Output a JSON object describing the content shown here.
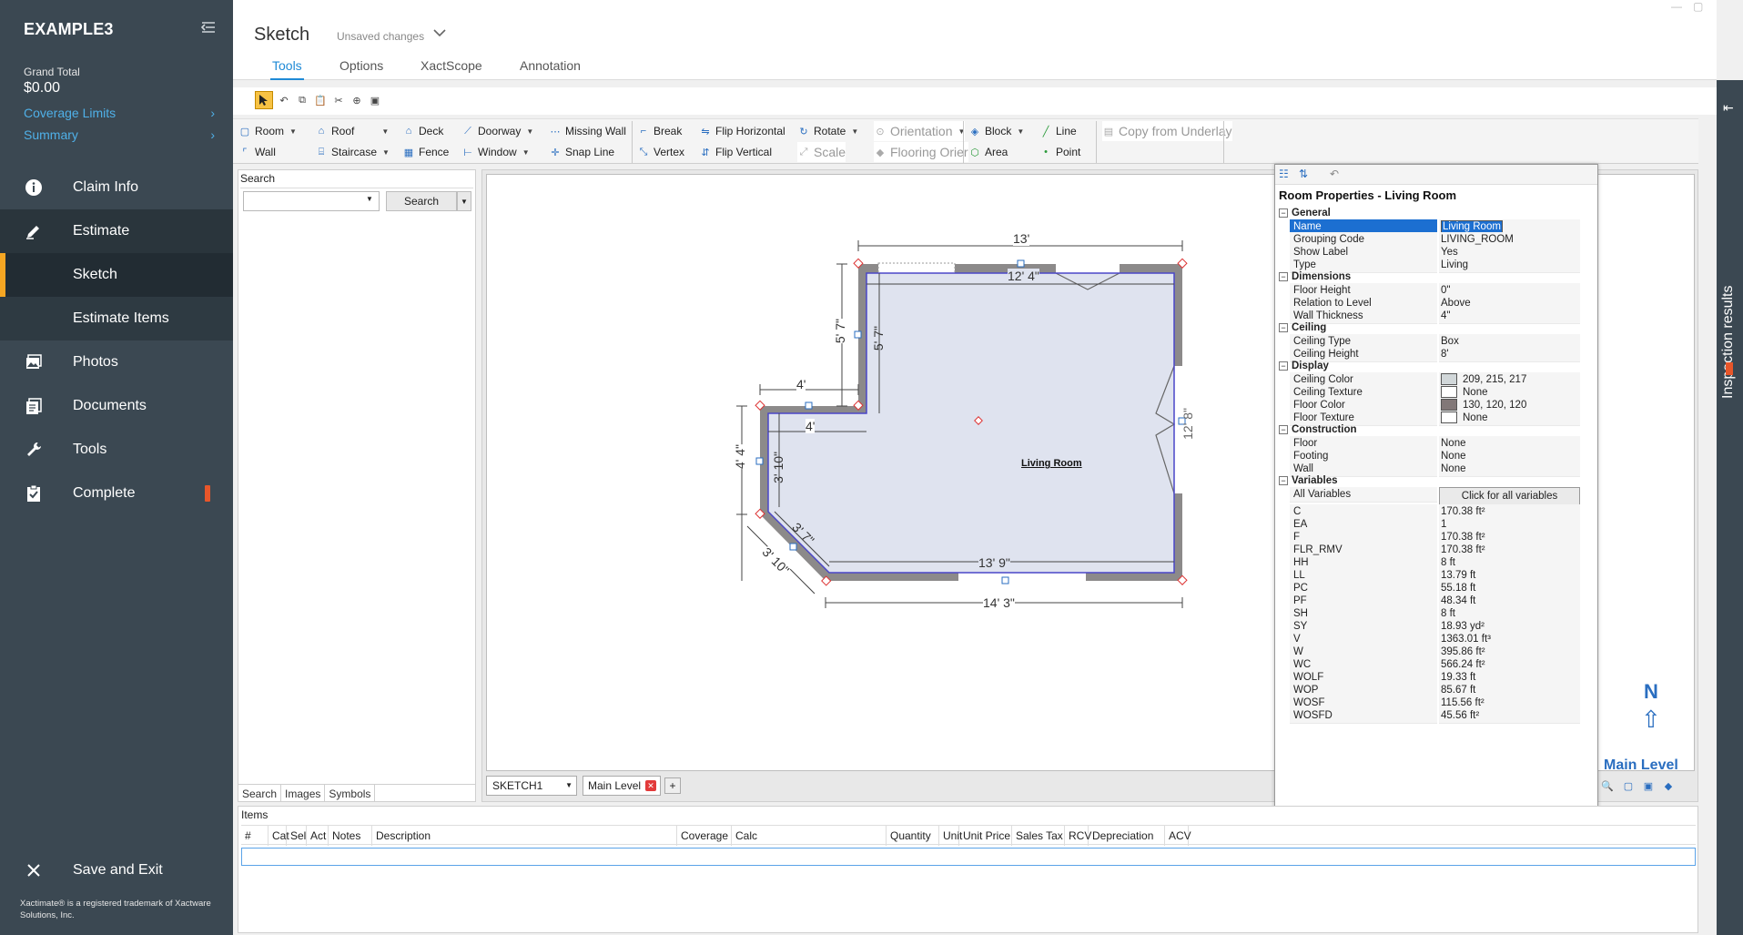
{
  "sidebar": {
    "project": "EXAMPLE3",
    "grand_total_label": "Grand Total",
    "grand_total_value": "$0.00",
    "links": [
      {
        "label": "Coverage Limits"
      },
      {
        "label": "Summary"
      }
    ],
    "nav": [
      {
        "label": "Claim Info",
        "icon": "info-icon"
      },
      {
        "label": "Estimate",
        "icon": "pencil-icon"
      },
      {
        "label": "Sketch",
        "icon": ""
      },
      {
        "label": "Estimate Items",
        "icon": ""
      },
      {
        "label": "Photos",
        "icon": "photos-icon"
      },
      {
        "label": "Documents",
        "icon": "documents-icon"
      },
      {
        "label": "Tools",
        "icon": "wrench-icon"
      },
      {
        "label": "Complete",
        "icon": "clipboard-check-icon"
      }
    ],
    "save_exit": "Save and Exit",
    "trademark": "Xactimate® is a registered trademark of Xactware Solutions, Inc."
  },
  "header": {
    "title": "Sketch",
    "status": "Unsaved changes",
    "tabs": [
      {
        "label": "Tools"
      },
      {
        "label": "Options"
      },
      {
        "label": "XactScope"
      },
      {
        "label": "Annotation"
      }
    ]
  },
  "ribbon": {
    "row1": [
      "Room",
      "Roof",
      "Deck",
      "Doorway",
      "Missing Wall",
      "Break",
      "Flip Horizontal",
      "Rotate",
      "Orientation",
      "Block",
      "Line",
      "Copy from Underlay"
    ],
    "row2": [
      "Wall",
      "Staircase",
      "Fence",
      "Window",
      "Snap Line",
      "Vertex",
      "Flip Vertical",
      "Scale",
      "Flooring Orier",
      "Area",
      "Point"
    ]
  },
  "search_panel": {
    "title": "Search",
    "input_value": "",
    "button": "Search",
    "tabs": [
      "Search",
      "Images",
      "Symbols"
    ]
  },
  "sketch": {
    "room_label": "Living Room",
    "dims": {
      "top_outer": "13'",
      "top_inner": "12' 4\"",
      "left_upper_outer": "5' 7\"",
      "left_upper_inner": "5' 7\"",
      "notch_outer": "4'",
      "notch_inner": "4'",
      "left_lower_outer": "4' 4\"",
      "left_lower_inner": "3' 10\"",
      "diag_inner": "3' 7\"",
      "diag_outer": "3' 10\"",
      "bottom_inner": "13' 9\"",
      "bottom_outer": "14' 3\"",
      "right_partial": "12' 8\""
    },
    "level_label": "Main Level",
    "north": "N",
    "sketch_select": "SKETCH1",
    "level_tab": "Main Level",
    "add_tab": "+"
  },
  "properties": {
    "title": "Room Properties - Living Room",
    "sections": [
      {
        "name": "General",
        "rows": [
          {
            "key": "Name",
            "value": "Living Room",
            "selected": true
          },
          {
            "key": "Grouping Code",
            "value": "LIVING_ROOM"
          },
          {
            "key": "Show Label",
            "value": "Yes"
          },
          {
            "key": "Type",
            "value": "Living"
          }
        ]
      },
      {
        "name": "Dimensions",
        "rows": [
          {
            "key": "Floor Height",
            "value": "0\""
          },
          {
            "key": "Relation to Level",
            "value": "Above"
          },
          {
            "key": "Wall Thickness",
            "value": "4\""
          }
        ]
      },
      {
        "name": "Ceiling",
        "rows": [
          {
            "key": "Ceiling Type",
            "value": "Box"
          },
          {
            "key": "Ceiling Height",
            "value": "8'"
          }
        ]
      },
      {
        "name": "Display",
        "rows": [
          {
            "key": "Ceiling Color",
            "value": "209, 215, 217",
            "swatch": "#d1d7d9"
          },
          {
            "key": "Ceiling Texture",
            "value": "None",
            "swatch": "#ffffff"
          },
          {
            "key": "Floor Color",
            "value": "130, 120, 120",
            "swatch": "#827878"
          },
          {
            "key": "Floor Texture",
            "value": "None",
            "swatch": "#ffffff"
          }
        ]
      },
      {
        "name": "Construction",
        "rows": [
          {
            "key": "Floor",
            "value": "None"
          },
          {
            "key": "Footing",
            "value": "None"
          },
          {
            "key": "Wall",
            "value": "None"
          }
        ]
      },
      {
        "name": "Variables",
        "rows": [
          {
            "key": "All Variables",
            "value": "Click for all variables",
            "button": true
          },
          {
            "key": "C",
            "value": "170.38 ft²"
          },
          {
            "key": "EA",
            "value": "1"
          },
          {
            "key": "F",
            "value": "170.38 ft²"
          },
          {
            "key": "FLR_RMV",
            "value": "170.38 ft²"
          },
          {
            "key": "HH",
            "value": "8 ft"
          },
          {
            "key": "LL",
            "value": "13.79 ft"
          },
          {
            "key": "PC",
            "value": "55.18 ft"
          },
          {
            "key": "PF",
            "value": "48.34 ft"
          },
          {
            "key": "SH",
            "value": "8 ft"
          },
          {
            "key": "SY",
            "value": "18.93 yd²"
          },
          {
            "key": "V",
            "value": "1363.01 ft³"
          },
          {
            "key": "W",
            "value": "395.86 ft²"
          },
          {
            "key": "WC",
            "value": "566.24 ft²"
          },
          {
            "key": "WOLF",
            "value": "19.33 ft"
          },
          {
            "key": "WOP",
            "value": "85.67 ft"
          },
          {
            "key": "WOSF",
            "value": "115.56 ft²"
          },
          {
            "key": "WOSFD",
            "value": "45.56 ft²"
          }
        ]
      }
    ]
  },
  "inspection": {
    "label": "Inspection results"
  },
  "items": {
    "title": "Items",
    "columns": [
      "#",
      "Cat",
      "Sel",
      "Act",
      "Notes",
      "Description",
      "Coverage",
      "Calc",
      "Quantity",
      "Unit",
      "Unit Price",
      "Sales Tax",
      "RCV",
      "Depreciation",
      "ACV"
    ]
  },
  "colors": {
    "sidebar": "#3b4852",
    "accent": "#1f8ad6",
    "selection": "#f5a623",
    "room_fill": "#dfe3ef",
    "wall": "#8c8a8a"
  }
}
